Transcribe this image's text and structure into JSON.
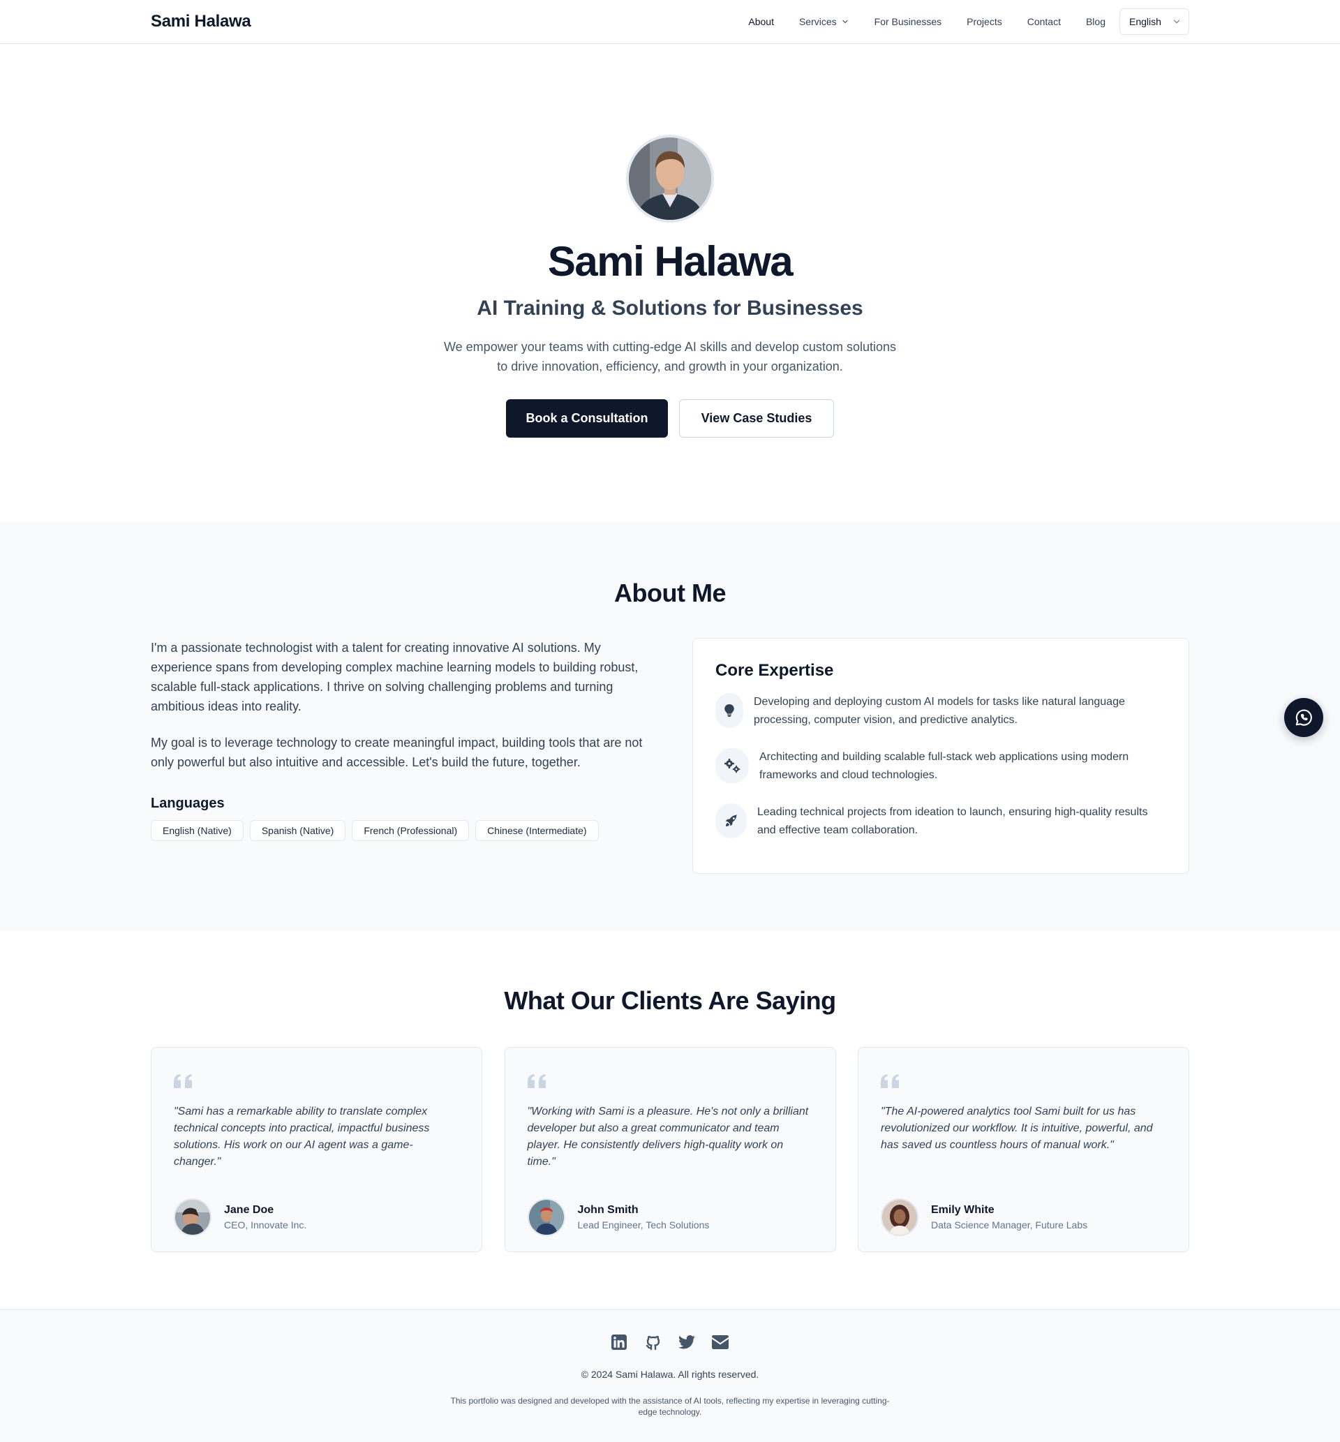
{
  "nav": {
    "brand": "Sami Halawa",
    "links": [
      {
        "label": "About"
      },
      {
        "label": "Services"
      },
      {
        "label": "For Businesses"
      },
      {
        "label": "Projects"
      },
      {
        "label": "Contact"
      },
      {
        "label": "Blog"
      }
    ],
    "language": "English"
  },
  "hero": {
    "name": "Sami Halawa",
    "tagline": "AI Training & Solutions for Businesses",
    "description": "We empower your teams with cutting-edge AI skills and develop custom solutions to drive innovation, efficiency, and growth in your organization.",
    "primary_button": "Book a Consultation",
    "secondary_button": "View Case Studies"
  },
  "about": {
    "title": "About Me",
    "paragraphs": [
      "I'm a passionate technologist with a talent for creating innovative AI solutions. My experience spans from developing complex machine learning models to building robust, scalable full-stack applications. I thrive on solving challenging problems and turning ambitious ideas into reality.",
      "My goal is to leverage technology to create meaningful impact, building tools that are not only powerful but also intuitive and accessible. Let's build the future, together."
    ],
    "languages_heading": "Languages",
    "languages": [
      "English (Native)",
      "Spanish (Native)",
      "French (Professional)",
      "Chinese (Intermediate)"
    ],
    "expertise": {
      "title": "Core Expertise",
      "items": [
        {
          "icon": "lightbulb-icon",
          "text": "Developing and deploying custom AI models for tasks like natural language processing, computer vision, and predictive analytics."
        },
        {
          "icon": "gears-icon",
          "text": "Architecting and building scalable full-stack web applications using modern frameworks and cloud technologies."
        },
        {
          "icon": "rocket-icon",
          "text": "Leading technical projects from ideation to launch, ensuring high-quality results and effective team collaboration."
        }
      ]
    }
  },
  "testimonials": {
    "title": "What Our Clients Are Saying",
    "items": [
      {
        "quote": "\"Sami has a remarkable ability to translate complex technical concepts into practical, impactful business solutions. His work on our AI agent was a game-changer.\"",
        "name": "Jane Doe",
        "role": "CEO, Innovate Inc."
      },
      {
        "quote": "\"Working with Sami is a pleasure. He's not only a brilliant developer but also a great communicator and team player. He consistently delivers high-quality work on time.\"",
        "name": "John Smith",
        "role": "Lead Engineer, Tech Solutions"
      },
      {
        "quote": "\"The AI-powered analytics tool Sami built for us has revolutionized our workflow. It is intuitive, powerful, and has saved us countless hours of manual work.\"",
        "name": "Emily White",
        "role": "Data Science Manager, Future Labs"
      }
    ]
  },
  "footer": {
    "socials": [
      "linkedin-icon",
      "github-icon",
      "twitter-icon",
      "email-icon"
    ],
    "copyright": "© 2024 Sami Halawa. All rights reserved.",
    "disclaimer": "This portfolio was designed and developed with the assistance of AI tools, reflecting my expertise in leveraging cutting-edge technology."
  },
  "colors": {
    "primary": "#0f172a",
    "muted_bg": "#f8fafc",
    "border": "#e5e7eb",
    "text": "#334155",
    "quote_icon": "#cbd5e1"
  }
}
